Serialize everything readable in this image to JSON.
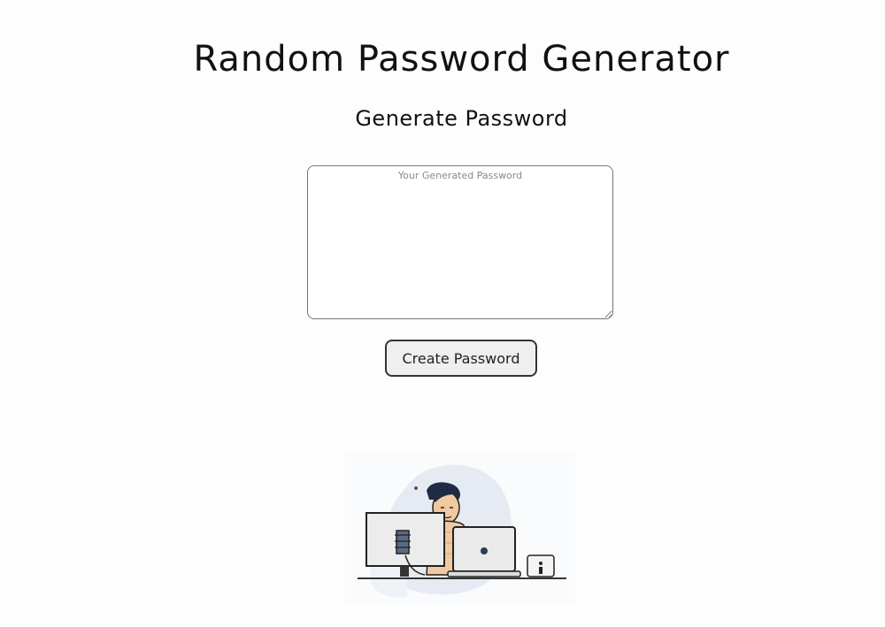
{
  "header": {
    "title": "Random Password Generator",
    "subtitle": "Generate Password"
  },
  "password_field": {
    "placeholder": "Your Generated Password",
    "value": ""
  },
  "create_button": {
    "label": "Create Password"
  },
  "illustration": {
    "icon": "person-at-computers-illustration"
  }
}
